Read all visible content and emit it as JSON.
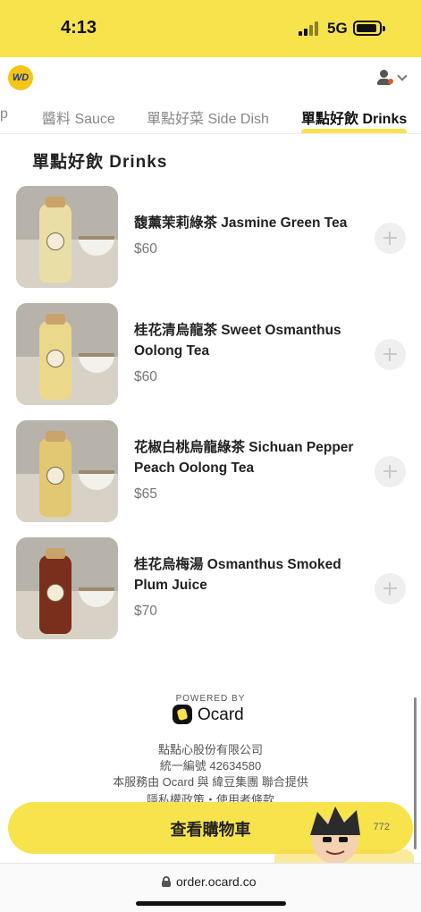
{
  "status_bar": {
    "time": "4:13",
    "network": "5G"
  },
  "header": {
    "logo_text": "WD"
  },
  "tabs": [
    {
      "label": "p"
    },
    {
      "label": "醬料 Sauce"
    },
    {
      "label": "單點好菜 Side Dish"
    },
    {
      "label": "單點好飲 Drinks"
    }
  ],
  "section_title": "單點好飲 Drinks",
  "items": [
    {
      "name": "馥薰茉莉綠茶 Jasmine Green Tea",
      "price": "$60",
      "bottle_color": "#e9dfa6"
    },
    {
      "name": "桂花清烏龍茶 Sweet Osmanthus Oolong Tea",
      "price": "$60",
      "bottle_color": "#ecd88a"
    },
    {
      "name": "花椒白桃烏龍綠茶 Sichuan Pepper Peach Oolong Tea",
      "price": "$65",
      "bottle_color": "#e2c873"
    },
    {
      "name": "桂花烏梅湯 Osmanthus Smoked Plum Juice",
      "price": "$70",
      "bottle_color": "#7a2e1c"
    }
  ],
  "footer": {
    "powered_by": "POWERED BY",
    "brand": "Ocard",
    "company": "點點心股份有限公司",
    "tax_id": "統一編號 42634580",
    "service": "本服務由 Ocard 與 緯豆集團 聯合提供",
    "policy": "隱私權政策・使用者條款"
  },
  "cart": {
    "label": "查看購物車",
    "count": "772"
  },
  "browser": {
    "url": "order.ocard.co"
  },
  "colors": {
    "accent": "#f7e34c"
  }
}
